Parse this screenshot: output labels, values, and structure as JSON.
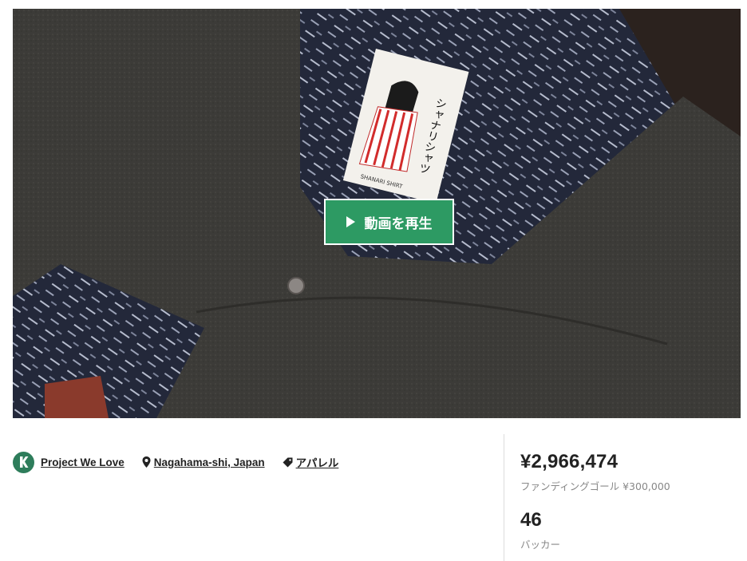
{
  "video": {
    "play_label": "動画を再生",
    "label_text": "シャナリシャツ",
    "label_brand": "SHANARI SHIRT"
  },
  "meta": {
    "creator": "Project We Love",
    "location": "Nagahama-shi, Japan",
    "category": "アパレル"
  },
  "stats": {
    "amount": "¥2,966,474",
    "goal": "ファンディングゴール ¥300,000",
    "backers": "46",
    "backers_label": "バッカー"
  },
  "colors": {
    "accent_green": "#2d9a63",
    "logo_green": "#2e7d5b"
  }
}
